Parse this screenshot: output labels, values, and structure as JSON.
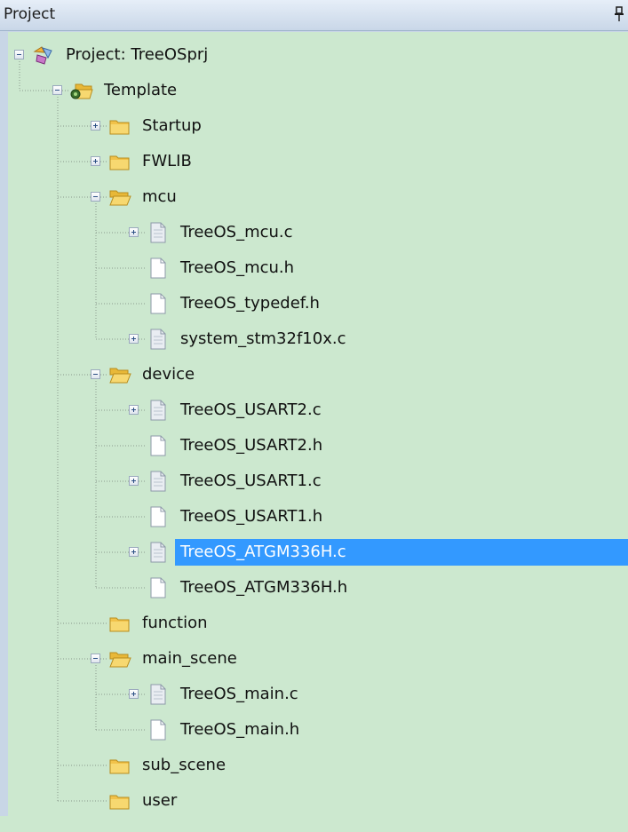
{
  "panel": {
    "title": "Project",
    "pin_icon": "pin-icon"
  },
  "colors": {
    "tree_background": "#cce8cf",
    "selection": "#3399ff",
    "header": "#c9d7e8"
  },
  "tree": [
    {
      "label": "Project: TreeOSprj",
      "icon": "project-icon",
      "depth": 0,
      "expanded": true,
      "toggle": "minus",
      "selected": false
    },
    {
      "label": "Template",
      "icon": "target-folder-icon",
      "depth": 1,
      "expanded": true,
      "toggle": "minus",
      "selected": false
    },
    {
      "label": "Startup",
      "icon": "folder-icon",
      "depth": 2,
      "toggle": "plus",
      "selected": false
    },
    {
      "label": "FWLIB",
      "icon": "folder-icon",
      "depth": 2,
      "toggle": "plus",
      "selected": false
    },
    {
      "label": "mcu",
      "icon": "open-folder-icon",
      "depth": 2,
      "toggle": "minus",
      "selected": false
    },
    {
      "label": "TreeOS_mcu.c",
      "icon": "source-file-icon",
      "depth": 3,
      "toggle": "plus",
      "selected": false
    },
    {
      "label": "TreeOS_mcu.h",
      "icon": "file-icon",
      "depth": 3,
      "toggle": "none",
      "selected": false
    },
    {
      "label": "TreeOS_typedef.h",
      "icon": "file-icon",
      "depth": 3,
      "toggle": "none",
      "selected": false
    },
    {
      "label": "system_stm32f10x.c",
      "icon": "source-file-icon",
      "depth": 3,
      "toggle": "plus",
      "selected": false
    },
    {
      "label": "device",
      "icon": "open-folder-icon",
      "depth": 2,
      "toggle": "minus",
      "selected": false
    },
    {
      "label": "TreeOS_USART2.c",
      "icon": "source-file-icon",
      "depth": 3,
      "toggle": "plus",
      "selected": false
    },
    {
      "label": "TreeOS_USART2.h",
      "icon": "file-icon",
      "depth": 3,
      "toggle": "none",
      "selected": false
    },
    {
      "label": "TreeOS_USART1.c",
      "icon": "source-file-icon",
      "depth": 3,
      "toggle": "plus",
      "selected": false
    },
    {
      "label": "TreeOS_USART1.h",
      "icon": "file-icon",
      "depth": 3,
      "toggle": "none",
      "selected": false
    },
    {
      "label": "TreeOS_ATGM336H.c",
      "icon": "source-file-icon",
      "depth": 3,
      "toggle": "plus",
      "selected": true
    },
    {
      "label": "TreeOS_ATGM336H.h",
      "icon": "file-icon",
      "depth": 3,
      "toggle": "none",
      "selected": false
    },
    {
      "label": "function",
      "icon": "folder-icon",
      "depth": 2,
      "toggle": "none",
      "selected": false
    },
    {
      "label": "main_scene",
      "icon": "open-folder-icon",
      "depth": 2,
      "toggle": "minus",
      "selected": false
    },
    {
      "label": "TreeOS_main.c",
      "icon": "source-file-icon",
      "depth": 3,
      "toggle": "plus",
      "selected": false
    },
    {
      "label": "TreeOS_main.h",
      "icon": "file-icon",
      "depth": 3,
      "toggle": "none",
      "selected": false
    },
    {
      "label": "sub_scene",
      "icon": "folder-icon",
      "depth": 2,
      "toggle": "none",
      "selected": false
    },
    {
      "label": "user",
      "icon": "folder-icon",
      "depth": 2,
      "toggle": "none",
      "selected": false
    }
  ]
}
